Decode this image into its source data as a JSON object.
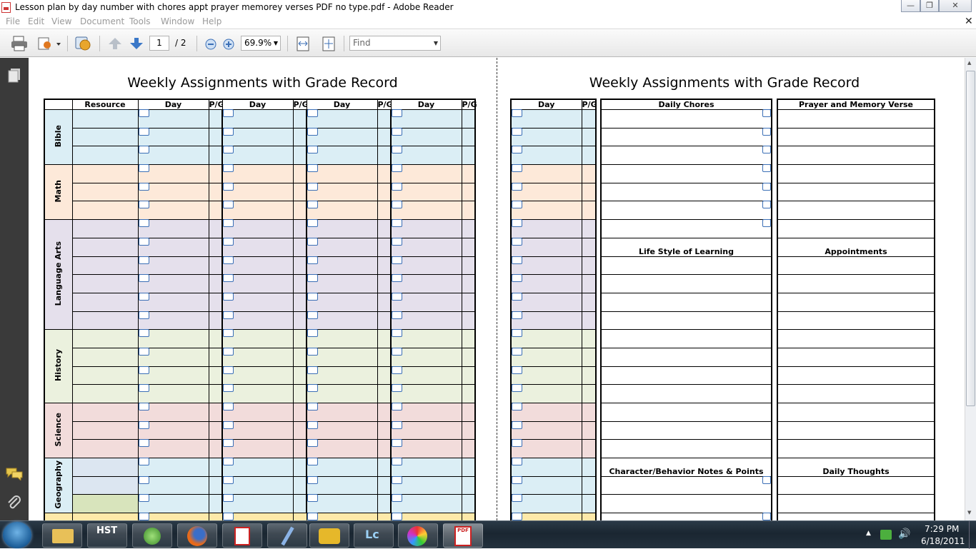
{
  "window": {
    "title": "Lesson plan by day number with chores appt prayer memorey verses PDF no type.pdf - Adobe Reader",
    "controls": {
      "minimize": "—",
      "restore": "❐",
      "close": "✕"
    }
  },
  "menu": {
    "items": [
      "File",
      "Edit",
      "View",
      "Document",
      "Tools",
      "Window",
      "Help"
    ],
    "close": "✕"
  },
  "toolbar": {
    "page_current": "1",
    "page_total": "/ 2",
    "zoom": "69.9%",
    "find_placeholder": "Find"
  },
  "page_left": {
    "title": "Weekly Assignments with Grade Record",
    "headers": [
      "Resource",
      "Day",
      "P/G",
      "Day",
      "P/G",
      "Day",
      "P/G",
      "Day",
      "P/G"
    ],
    "subjects": [
      {
        "name": "Bible",
        "rows": 3,
        "color": "#dbeef5"
      },
      {
        "name": "Math",
        "rows": 3,
        "color": "#fde9d9"
      },
      {
        "name": "Language Arts",
        "rows": 6,
        "color": "#e5e0ec"
      },
      {
        "name": "History",
        "rows": 4,
        "color": "#ebf1de"
      },
      {
        "name": "Science",
        "rows": 3,
        "color": "#f2dcdb"
      },
      {
        "name": "Geography",
        "rows": 3,
        "color": "#dbeef5"
      }
    ]
  },
  "page_right": {
    "title": "Weekly Assignments with Grade Record",
    "headers": {
      "day": "Day",
      "pg": "P/G",
      "chores": "Daily Chores",
      "prayer": "Prayer and Memory Verse"
    },
    "section_labels": {
      "lifestyle": "Life Style of Learning",
      "appointments": "Appointments",
      "character": "Character/Behavior Notes & Points",
      "thoughts": "Daily Thoughts"
    }
  },
  "taskbar": {
    "apps": [
      "start",
      "explorer",
      "HST",
      "messenger",
      "firefox",
      "vz",
      "pen",
      "bird",
      "Lc",
      "picasa",
      "adobe-pdf"
    ],
    "hst_label": "HST",
    "lc_label": "Lc",
    "pdf_label": "PDF",
    "time": "7:29 PM",
    "date": "6/18/2011"
  },
  "colors": {
    "bible": "#dbeef5",
    "math": "#fde9d9",
    "language_arts": "#e5e0ec",
    "history": "#ebf1de",
    "science": "#f2dcdb",
    "geography": "#dbeef5",
    "checkbox": "#3b6fb6"
  }
}
